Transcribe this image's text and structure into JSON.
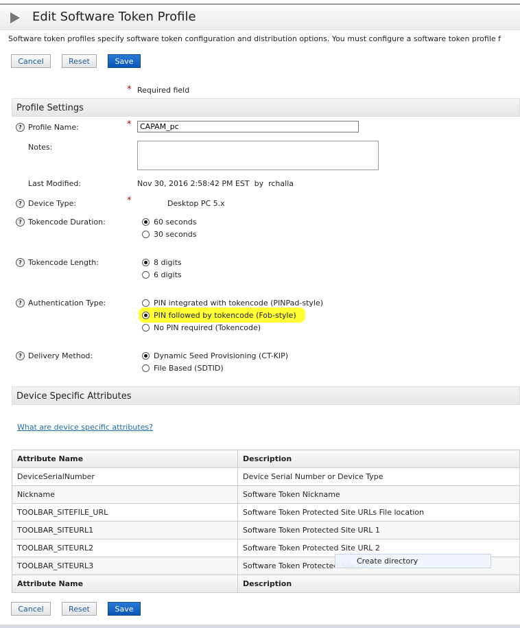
{
  "title": "Edit Software Token Profile",
  "description": "Software token profiles specify software token configuration and distribution options. You must configure a software token profile f",
  "buttons": {
    "cancel": "Cancel",
    "reset": "Reset",
    "save": "Save"
  },
  "required_star": "*",
  "required_label": "Required field",
  "profile_settings": {
    "header": "Profile Settings",
    "profile_name_label": "Profile Name:",
    "profile_name_value": "CAPAM_pc",
    "notes_label": "Notes:",
    "notes_value": "",
    "last_modified_label": "Last Modified:",
    "last_modified_value": "Nov 30, 2016 2:58:42 PM EST  by  rchalla",
    "device_type_label": "Device Type:",
    "device_type_value": "Desktop PC 5.x",
    "tokencode_duration_label": "Tokencode Duration:",
    "tokencode_duration_options": [
      "60 seconds",
      "30 seconds"
    ],
    "tokencode_length_label": "Tokencode Length:",
    "tokencode_length_options": [
      "8 digits",
      "6 digits"
    ],
    "auth_type_label": "Authentication Type:",
    "auth_type_options": [
      "PIN integrated with tokencode (PINPad-style)",
      "PIN followed by tokencode (Fob-style)",
      "No PIN required (Tokencode)"
    ],
    "delivery_label": "Delivery Method:",
    "delivery_options": [
      "Dynamic Seed Provisioning (CT-KIP)",
      "File Based (SDTID)"
    ]
  },
  "device_attributes": {
    "header": "Device Specific Attributes",
    "help_link": "What are device specific attributes?",
    "columns": [
      "Attribute Name",
      "Description"
    ],
    "rows": [
      [
        "DeviceSerialNumber",
        "Device Serial Number or Device Type"
      ],
      [
        "Nickname",
        "Software Token Nickname"
      ],
      [
        "TOOLBAR_SITEFILE_URL",
        "Software Token Protected Site URLs File location"
      ],
      [
        "TOOLBAR_SITEURL1",
        "Software Token Protected Site URL 1"
      ],
      [
        "TOOLBAR_SITEURL2",
        "Software Token Protected Site URL 2"
      ],
      [
        "TOOLBAR_SITEURL3",
        "Software Token Protected Site URL 3"
      ]
    ]
  },
  "tooltip": "Create directory",
  "highlight_color": "#ffff33"
}
